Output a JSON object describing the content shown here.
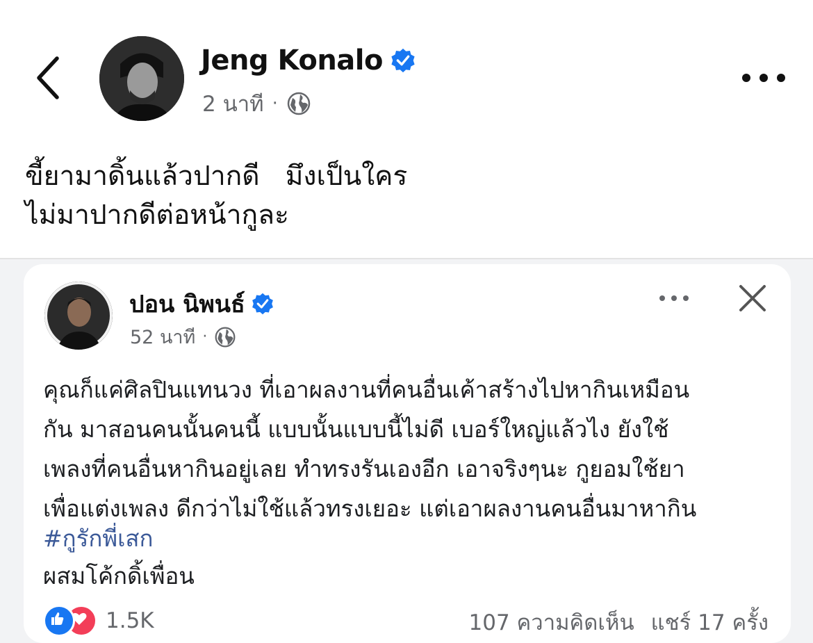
{
  "post": {
    "author_name": "Jeng Konalo",
    "time": "2 นาที",
    "separator": "·",
    "audience_icon": "globe-icon",
    "text": "ขี้ยามาดิ้นแล้วปากดี   มึงเป็นใคร\nไม่มาปากดีต่อหน้ากูละ"
  },
  "shared_post": {
    "author_name": "ปอน นิพนธ์",
    "time": "52 นาที",
    "separator": "·",
    "text": "คุณก็แค่ศิลปินแทนวง ที่เอาผลงานที่คนอื่นเค้าสร้างไปหากินเหมือน\nกัน มาสอนคนนั้นคนนี้ แบบนั้นแบบนี้ไม่ดี เบอร์ใหญ่แล้วไง ยังใช้\nเพลงที่คนอื่นหากินอยู่เลย ทำทรงรันเองอีก เอาจริงๆนะ กูยอมใช้ยา\nเพื่อแต่งเพลง ดีกว่าไม่ใช้แล้วทรงเยอะ แต่เอาผลงานคนอื่นมาหากิน",
    "hashtag": "#กูรักพี่เสก",
    "tail_text": "ผสมโค้กดิ้เพื่อน",
    "reaction_count": "1.5K",
    "comments": "107 ความคิดเห็น",
    "shares": "แชร์ 17 ครั้ง"
  },
  "colors": {
    "verified": "#1877f2",
    "hashtag": "#3b5998",
    "muted": "#65676b",
    "like": "#1877f2",
    "love": "#f33e58"
  }
}
